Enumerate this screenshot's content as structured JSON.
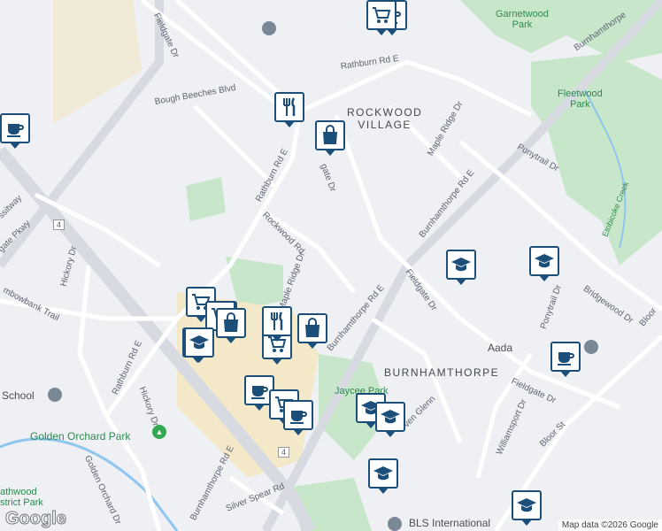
{
  "map": {
    "labels": {
      "fieldgate_dr_n": "Fieldgate Dr",
      "rathburn_top": "Rathburn Rd E",
      "bough_beeches": "Bough Beeches Blvd",
      "rathburn_mid": "Rathburn Rd E",
      "rockwood_village": "ROCKWOOD\nVILLAGE",
      "maple_ridge_ne": "Maple Ridge Dr",
      "garnetwood_park": "Garnetwood\nPark",
      "burnhamthorpe_ne": "Burnhamthorpe",
      "fleetwood_park": "Fleetwood\nPark",
      "ponytrail_n": "Ponytrail Dr",
      "etobicoke_creek": "Etobicoke Creek",
      "burnhamthorpe_mid": "Burnhamthorpe Rd E",
      "gate_dr": "gate Dr",
      "rockwood_rd": "Rockwood Rd",
      "maple_ridge_mid": "Maple Ridge Dr",
      "busway": "ssitway",
      "gate_pkwy": "gate Pkwy",
      "hwy4_a": "4",
      "hickory_n": "Hickory Dr",
      "mbowbank": "mbowbank Trail",
      "burnhamthorpe_s": "Burnhamthorpe Rd E",
      "fieldgate_s": "Fieldgate Dr",
      "bridgewood": "Bridgewood Dr",
      "ponytrail_s": "Ponytrail Dr",
      "bloor_n": "Bloor",
      "aada": "Aada",
      "burnhamthorpe_area": "BURNHAMTHORPE",
      "fieldgate_se": "Fieldgate Dr",
      "rathburn_sw": "Rathburn Rd E",
      "hickory_s": "Hickory Dr",
      "jaycee_park": "Jaycee Park",
      "haven_glenn": "ven Glenn",
      "williamsport": "Williamsport Dr",
      "bloor_st": "Bloor St",
      "school": "School",
      "golden_orchard_park": "Golden Orchard Park",
      "golden_orchard_dr": "Golden Orchard Dr",
      "burnhamthorpe_sw": "Burnhamthorpe Rd E",
      "hwy4_b": "4",
      "silver_spear": "Silver Spear Rd",
      "heathwood": "athwood\nstrict Park",
      "bls": "BLS International"
    },
    "pois": [
      {
        "icon": "cup-icon"
      },
      {
        "icon": "cup-icon"
      },
      {
        "icon": "cart-icon"
      },
      {
        "icon": "restaurant-icon"
      },
      {
        "icon": "shopping-bag-icon"
      },
      {
        "icon": "cup-icon"
      },
      {
        "icon": "school-icon"
      },
      {
        "icon": "school-icon"
      },
      {
        "icon": "cart-icon"
      },
      {
        "icon": "cup-icon"
      },
      {
        "icon": "cart-icon"
      },
      {
        "icon": "shopping-bag-icon"
      },
      {
        "icon": "cart-icon"
      },
      {
        "icon": "restaurant-icon"
      },
      {
        "icon": "shopping-bag-icon"
      },
      {
        "icon": "cup-icon"
      },
      {
        "icon": "cup-icon"
      },
      {
        "icon": "cart-icon"
      },
      {
        "icon": "cup-icon"
      },
      {
        "icon": "school-icon"
      },
      {
        "icon": "school-icon"
      },
      {
        "icon": "school-icon"
      },
      {
        "icon": "school-icon"
      },
      {
        "icon": "school-icon"
      }
    ],
    "colors": {
      "pin_border": "#1b4f7a",
      "park": "#c8e6c9",
      "water": "#8ec6f0",
      "road": "#ffffff",
      "highway": "#d7dbe1"
    }
  },
  "branding": {
    "logo": "Google"
  },
  "attribution": "Map data ©2026 Google"
}
